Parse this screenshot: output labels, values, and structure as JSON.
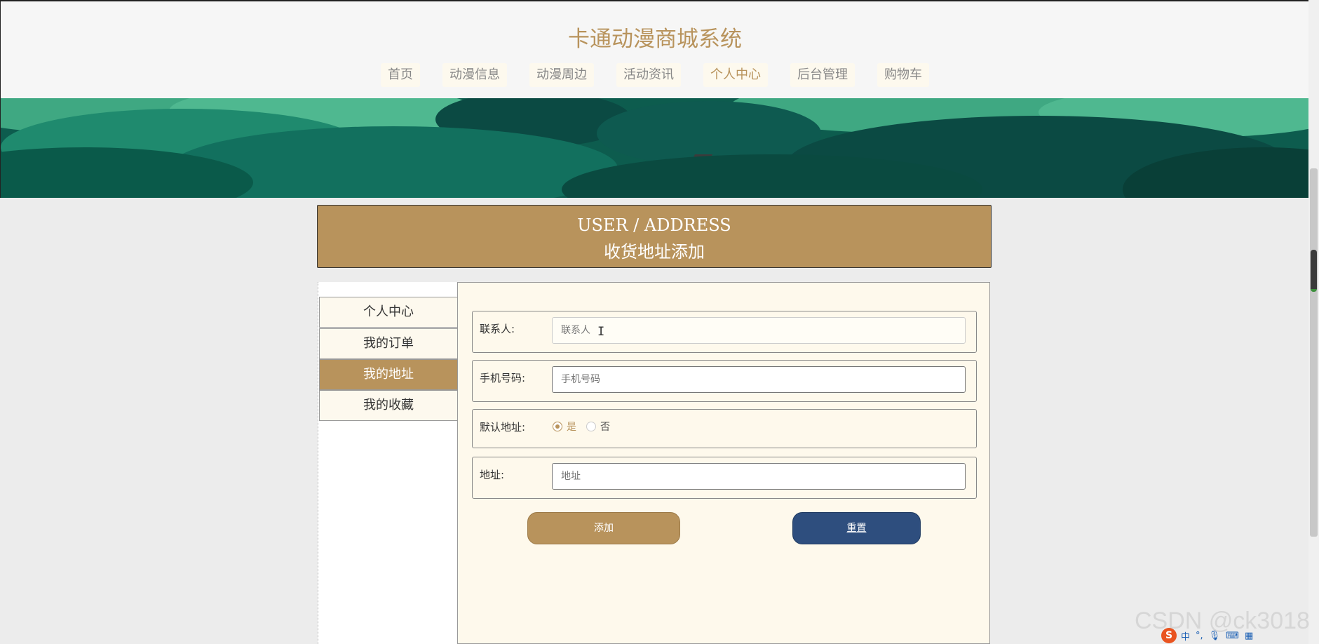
{
  "header": {
    "site_title": "卡通动漫商城系统",
    "nav": [
      "首页",
      "动漫信息",
      "动漫周边",
      "活动资讯",
      "个人中心",
      "后台管理",
      "购物车"
    ],
    "active_nav": "个人中心"
  },
  "page_title": {
    "en": "USER / ADDRESS",
    "zh": "收货地址添加"
  },
  "sidebar": {
    "items": [
      "个人中心",
      "我的订单",
      "我的地址",
      "我的收藏"
    ],
    "active": "我的地址"
  },
  "form": {
    "contact": {
      "label": "联系人:",
      "placeholder": "联系人"
    },
    "phone": {
      "label": "手机号码:",
      "placeholder": "手机号码"
    },
    "default": {
      "label": "默认地址:",
      "options": [
        "是",
        "否"
      ],
      "selected": "是"
    },
    "address": {
      "label": "地址:",
      "placeholder": "地址"
    },
    "add_label": "添加",
    "reset_label": "重置"
  },
  "overlay": {
    "watermark": "CSDN @ck3018",
    "ime_logo": "S",
    "ime_mode": "中"
  },
  "colors": {
    "accent": "#b8935c",
    "reset_button": "#2e4e7e",
    "panel_bg": "#fef9ec"
  }
}
